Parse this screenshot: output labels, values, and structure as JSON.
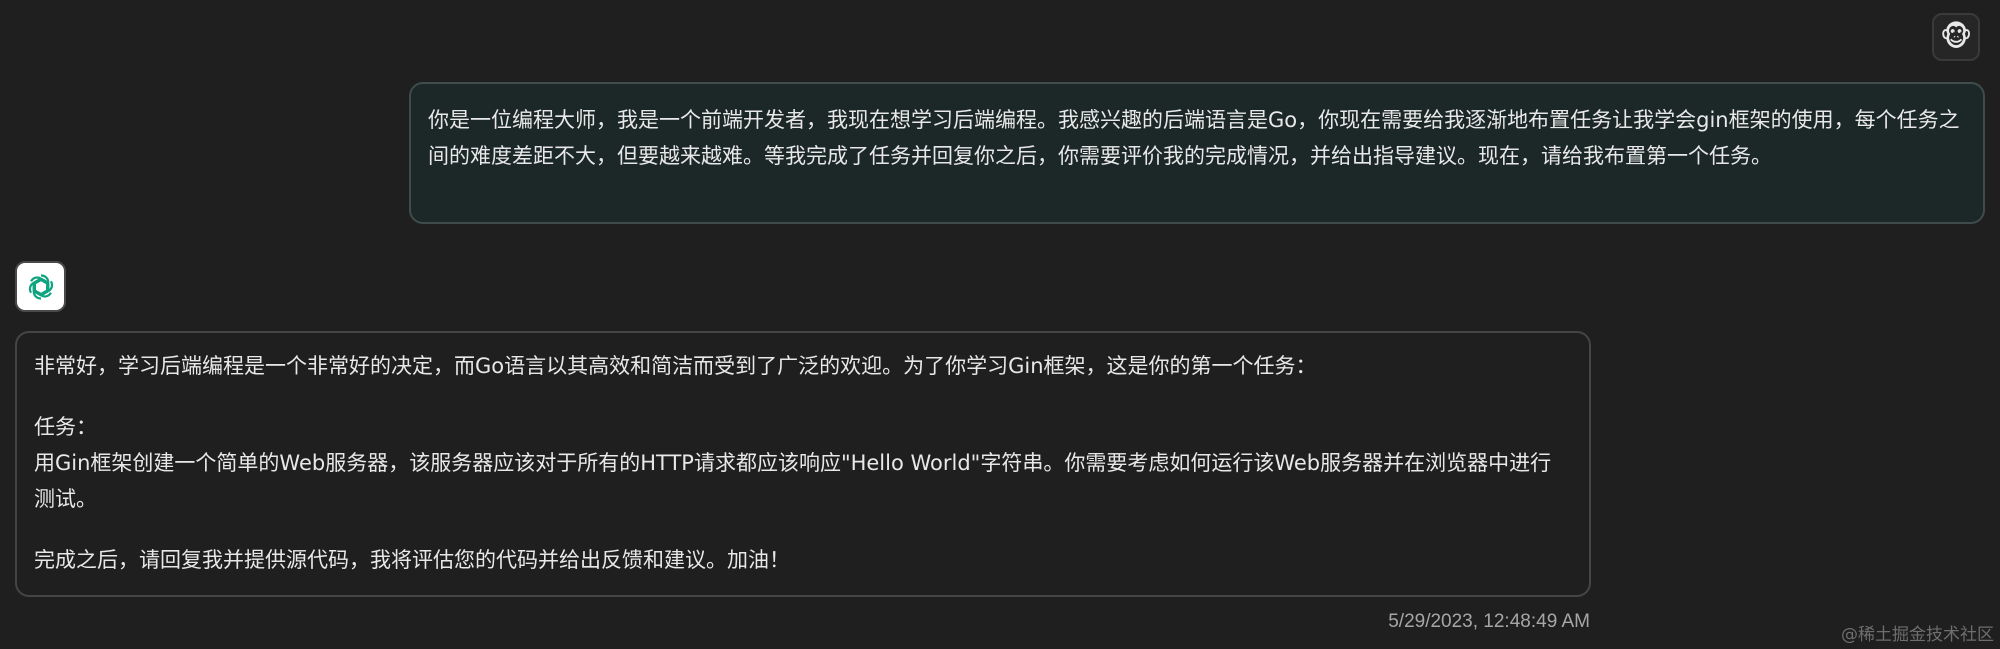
{
  "user": {
    "avatar_emoji": "🐵",
    "message": "你是一位编程大师，我是一个前端开发者，我现在想学习后端编程。我感兴趣的后端语言是Go，你现在需要给我逐渐地布置任务让我学会gin框架的使用，每个任务之间的难度差距不大，但要越来越难。等我完成了任务并回复你之后，你需要评价我的完成情况，并给出指导建议。现在，请给我布置第一个任务。"
  },
  "assistant": {
    "avatar_icon": "openai-logo-icon",
    "intro": "非常好，学习后端编程是一个非常好的决定，而Go语言以其高效和简洁而受到了广泛的欢迎。为了你学习Gin框架，这是你的第一个任务：",
    "task_heading": "任务：",
    "task_body": "用Gin框架创建一个简单的Web服务器，该服务器应该对于所有的HTTP请求都应该响应\"Hello World\"字符串。你需要考虑如何运行该Web服务器并在浏览器中进行测试。",
    "closing": "完成之后，请回复我并提供源代码，我将评估您的代码并给出反馈和建议。加油！",
    "timestamp": "5/29/2023, 12:48:49 AM"
  },
  "watermark": "@稀土掘金技术社区",
  "colors": {
    "background": "#1f1f1f",
    "user_bubble": "#1c2727",
    "user_bubble_border": "#404c4c",
    "bot_bubble_border": "#454545",
    "openai_green": "#10a37f"
  }
}
